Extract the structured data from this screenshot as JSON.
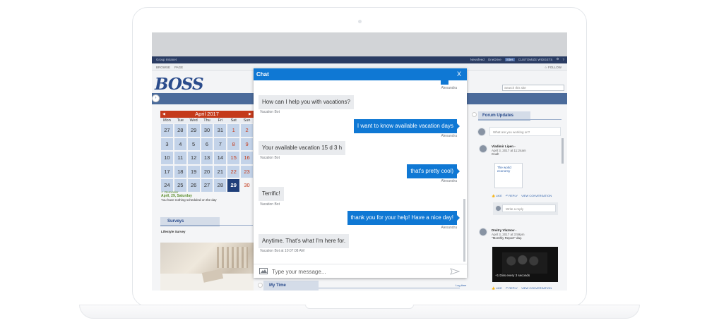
{
  "sharepoint": {
    "suite_title": "Group Intranet",
    "suite_links": [
      "Newsfeed",
      "OneDrive",
      "Sites"
    ],
    "customize_label": "CUSTOMIZE WIDGETS",
    "ribbon_tabs": [
      "BROWSE",
      "PAGE"
    ],
    "follow_label": "FOLLOW",
    "logo_text": "BOSS",
    "search_placeholder": "Search this site"
  },
  "calendar": {
    "month_label": "April 2017",
    "weekdays": [
      "Mon",
      "Tue",
      "Wed",
      "Thu",
      "Fri",
      "Sat",
      "Sun"
    ],
    "weeks": [
      [
        "27",
        "28",
        "29",
        "30",
        "31",
        "1",
        "2"
      ],
      [
        "3",
        "4",
        "5",
        "6",
        "7",
        "8",
        "9"
      ],
      [
        "10",
        "11",
        "12",
        "13",
        "14",
        "15",
        "16"
      ],
      [
        "17",
        "18",
        "19",
        "20",
        "21",
        "22",
        "23"
      ],
      [
        "24",
        "25",
        "26",
        "27",
        "28",
        "29",
        "30"
      ]
    ],
    "today": "29",
    "reminder_label": "Reminder",
    "selected_date": "April, 29, Saturday",
    "schedule_note": "You have nothing scheduled on the day"
  },
  "surveys": {
    "header": "Surveys",
    "item": "Lifestyle Survey"
  },
  "my_time": {
    "header": "My Time",
    "log_label": "Log time"
  },
  "forum": {
    "header": "Forum Updates",
    "input_placeholder": "What are you working on?",
    "posts": [
      {
        "author": "Vladimir Lipen -",
        "time": "April 3, 2017 at 11:24am",
        "text": "Cool!",
        "link_title": "The world economy"
      },
      {
        "author": "Dmitry Vlaznov -",
        "time": "April 3, 2017 at 3:59pm",
        "text": "\"Monthly Report\" day.",
        "video_caption": "+1 Diss every 3 seconds"
      }
    ],
    "actions": [
      "LIKE",
      "REPLY",
      "VIEW CONVERSATION"
    ],
    "reply_placeholder": "Write a reply"
  },
  "chat": {
    "title": "Chat",
    "close_label": "X",
    "top_meta": "Alexandra",
    "messages": [
      {
        "from": "bot",
        "text": "How can I help you with vacations?",
        "meta": "Vacation Bot"
      },
      {
        "from": "user",
        "text": "I want to know available vacation days",
        "meta": "Alexandra"
      },
      {
        "from": "bot",
        "text": "Your available vacation 15 d 3 h",
        "meta": "Vacation Bot"
      },
      {
        "from": "user",
        "text": "that's pretty cool)",
        "meta": "Alexandra"
      },
      {
        "from": "bot",
        "text": "Terrific!",
        "meta": "Vacation Bot"
      },
      {
        "from": "user",
        "text": "thank you for your help! Have a nice day!",
        "meta": "Alexandra"
      },
      {
        "from": "bot",
        "text": "Anytime. That's what I'm here for.",
        "meta": "Vacation Bot at 10:07:08 AM"
      }
    ],
    "input_placeholder": "Type your message...",
    "icons": {
      "attach": "image-icon",
      "send": "send-icon"
    },
    "accent_color": "#0f78d4"
  }
}
